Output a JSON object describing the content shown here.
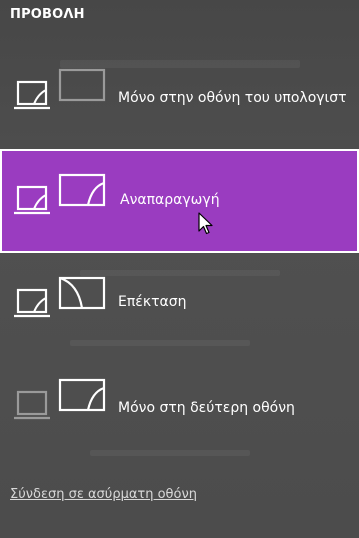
{
  "panel": {
    "title": "ΠΡΟΒΟΛΗ",
    "options": [
      {
        "label": "Μόνο στην οθόνη του υπολογιστ",
        "icon": "pc-screen-only-icon",
        "selected": false
      },
      {
        "label": "Αναπαραγωγή",
        "icon": "duplicate-icon",
        "selected": true
      },
      {
        "label": "Επέκταση",
        "icon": "extend-icon",
        "selected": false
      },
      {
        "label": "Μόνο στη δεύτερη οθόνη",
        "icon": "second-screen-only-icon",
        "selected": false
      }
    ],
    "wireless_link": "Σύνδεση σε ασύρματη οθόνη"
  },
  "colors": {
    "accent": "#9a3cc0",
    "background": "#4f4f4f",
    "text": "#ffffff"
  }
}
